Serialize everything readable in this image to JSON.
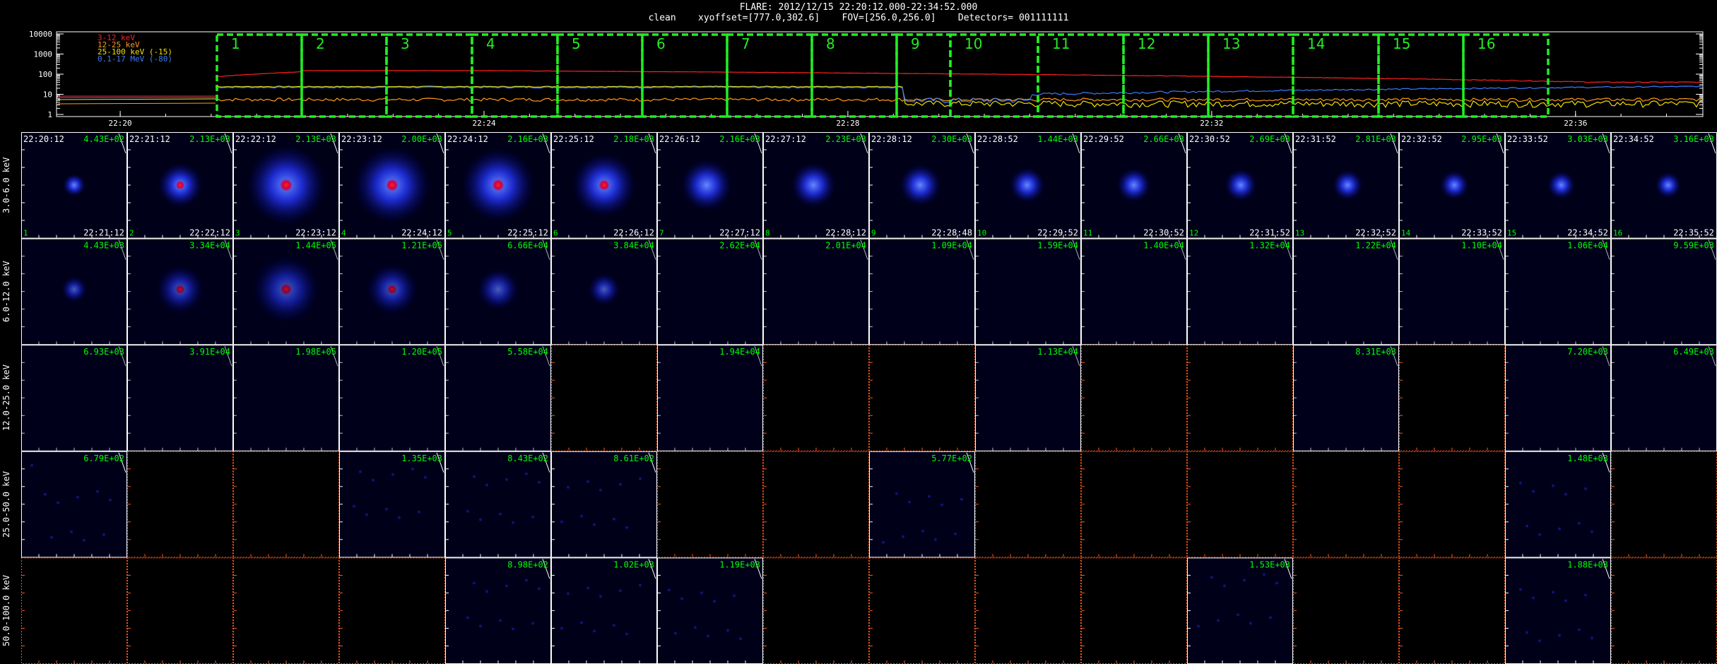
{
  "header": {
    "title": "FLARE: 2012/12/15 22:20:12.000-22:34:52.000",
    "subtitle": "clean    xyoffset=[777.0,302.6]    FOV=[256.0,256.0]    Detectors= 001111111"
  },
  "lightcurve": {
    "yticks": [
      "10000",
      "1000",
      "100",
      "10",
      "1"
    ],
    "xticks": [
      "22:20",
      "22:24",
      "22:28",
      "22:32",
      "22:36"
    ],
    "legend": [
      {
        "label": "3-12 keV",
        "color": "#ff2020"
      },
      {
        "label": "12-25 keV",
        "color": "#ff9a1a"
      },
      {
        "label": "25-100 keV (-15)",
        "color": "#f0e000"
      },
      {
        "label": "0.1-17 MeV (-80)",
        "color": "#3a7cff"
      }
    ],
    "intervals": [
      "1",
      "2",
      "3",
      "4",
      "5",
      "6",
      "7",
      "8",
      "9",
      "10",
      "11",
      "12",
      "13",
      "14",
      "15",
      "16"
    ]
  },
  "grid": {
    "energy_bands": [
      "3.0-6.0 keV",
      "6.0-12.0 keV",
      "12.0-25.0 keV",
      "25.0-50.0 keV",
      "50.0-100.0 keV"
    ],
    "start_times": [
      "22:20:12",
      "22:21:12",
      "22:22:12",
      "22:23:12",
      "22:24:12",
      "22:25:12",
      "22:26:12",
      "22:27:12",
      "22:28:12",
      "22:28:52",
      "22:29:52",
      "22:30:52",
      "22:31:52",
      "22:32:52",
      "22:33:52",
      "22:34:52"
    ],
    "end_times": [
      "22:21:12",
      "22:22:12",
      "22:23:12",
      "22:24:12",
      "22:25:12",
      "22:26:12",
      "22:27:12",
      "22:28:12",
      "22:28:48",
      "22:29:52",
      "22:30:52",
      "22:31:52",
      "22:32:52",
      "22:33:52",
      "22:34:52",
      "22:35:52"
    ],
    "interval_numbers": [
      "1",
      "2",
      "3",
      "4",
      "5",
      "6",
      "7",
      "8",
      "9",
      "10",
      "11",
      "12",
      "13",
      "14",
      "15",
      "16"
    ],
    "max_values": [
      [
        "4.43E+02",
        "2.13E+03",
        "2.13E+03",
        "2.00E+03",
        "2.16E+03",
        "2.18E+03",
        "2.16E+03",
        "2.23E+03",
        "2.30E+03",
        "1.44E+03",
        "2.66E+03",
        "2.69E+03",
        "2.81E+03",
        "2.95E+03",
        "3.03E+03",
        "3.16E+03"
      ],
      [
        "4.43E+03",
        "3.34E+04",
        "1.44E+05",
        "1.21E+05",
        "6.66E+04",
        "3.84E+04",
        "2.62E+04",
        "2.01E+04",
        "1.09E+04",
        "1.59E+04",
        "1.40E+04",
        "1.32E+04",
        "1.22E+04",
        "1.10E+04",
        "1.06E+04",
        "9.59E+03"
      ],
      [
        "6.93E+03",
        "3.91E+04",
        "1.98E+05",
        "1.20E+05",
        "5.58E+04",
        "",
        "1.94E+04",
        "",
        "",
        "1.13E+04",
        "",
        "",
        "8.31E+03",
        "",
        "7.20E+03",
        "6.49E+03"
      ],
      [
        "6.79E+02",
        "",
        "",
        "1.35E+03",
        "8.43E+02",
        "8.61E+02",
        "",
        "",
        "5.77E+02",
        "",
        "",
        "",
        "",
        "",
        "1.48E+03",
        ""
      ],
      [
        "",
        "",
        "",
        "",
        "8.98E+02",
        "1.02E+03",
        "1.19E+03",
        "",
        "",
        "",
        "",
        "1.53E+03",
        "",
        "",
        "1.88E+03",
        ""
      ]
    ],
    "image_present": [
      [
        1,
        1,
        1,
        1,
        1,
        1,
        1,
        1,
        1,
        1,
        1,
        1,
        1,
        1,
        1,
        1
      ],
      [
        1,
        1,
        1,
        1,
        1,
        1,
        1,
        1,
        1,
        1,
        1,
        1,
        1,
        1,
        1,
        1
      ],
      [
        1,
        1,
        1,
        1,
        1,
        0,
        1,
        0,
        0,
        1,
        0,
        0,
        1,
        0,
        1,
        1
      ],
      [
        1,
        0,
        0,
        1,
        1,
        1,
        0,
        0,
        1,
        0,
        0,
        0,
        0,
        0,
        1,
        0
      ],
      [
        0,
        0,
        0,
        0,
        1,
        1,
        1,
        0,
        0,
        0,
        0,
        1,
        0,
        0,
        1,
        0
      ]
    ],
    "source_strength": [
      [
        0.1,
        0.45,
        1.0,
        0.95,
        0.9,
        0.75,
        0.55,
        0.45,
        0.4,
        0.3,
        0.28,
        0.25,
        0.22,
        0.2,
        0.18,
        0.15
      ],
      [
        0.15,
        0.5,
        0.8,
        0.55,
        0.4,
        0.25,
        0.0,
        0.0,
        0.0,
        0.0,
        0.0,
        0.0,
        0.0,
        0.0,
        0.0,
        0.0
      ]
    ],
    "colors": {
      "frame_on": "#ffffff",
      "frame_off": "#ff5a1a",
      "label": "#00ff00",
      "bg": "#000018"
    }
  }
}
